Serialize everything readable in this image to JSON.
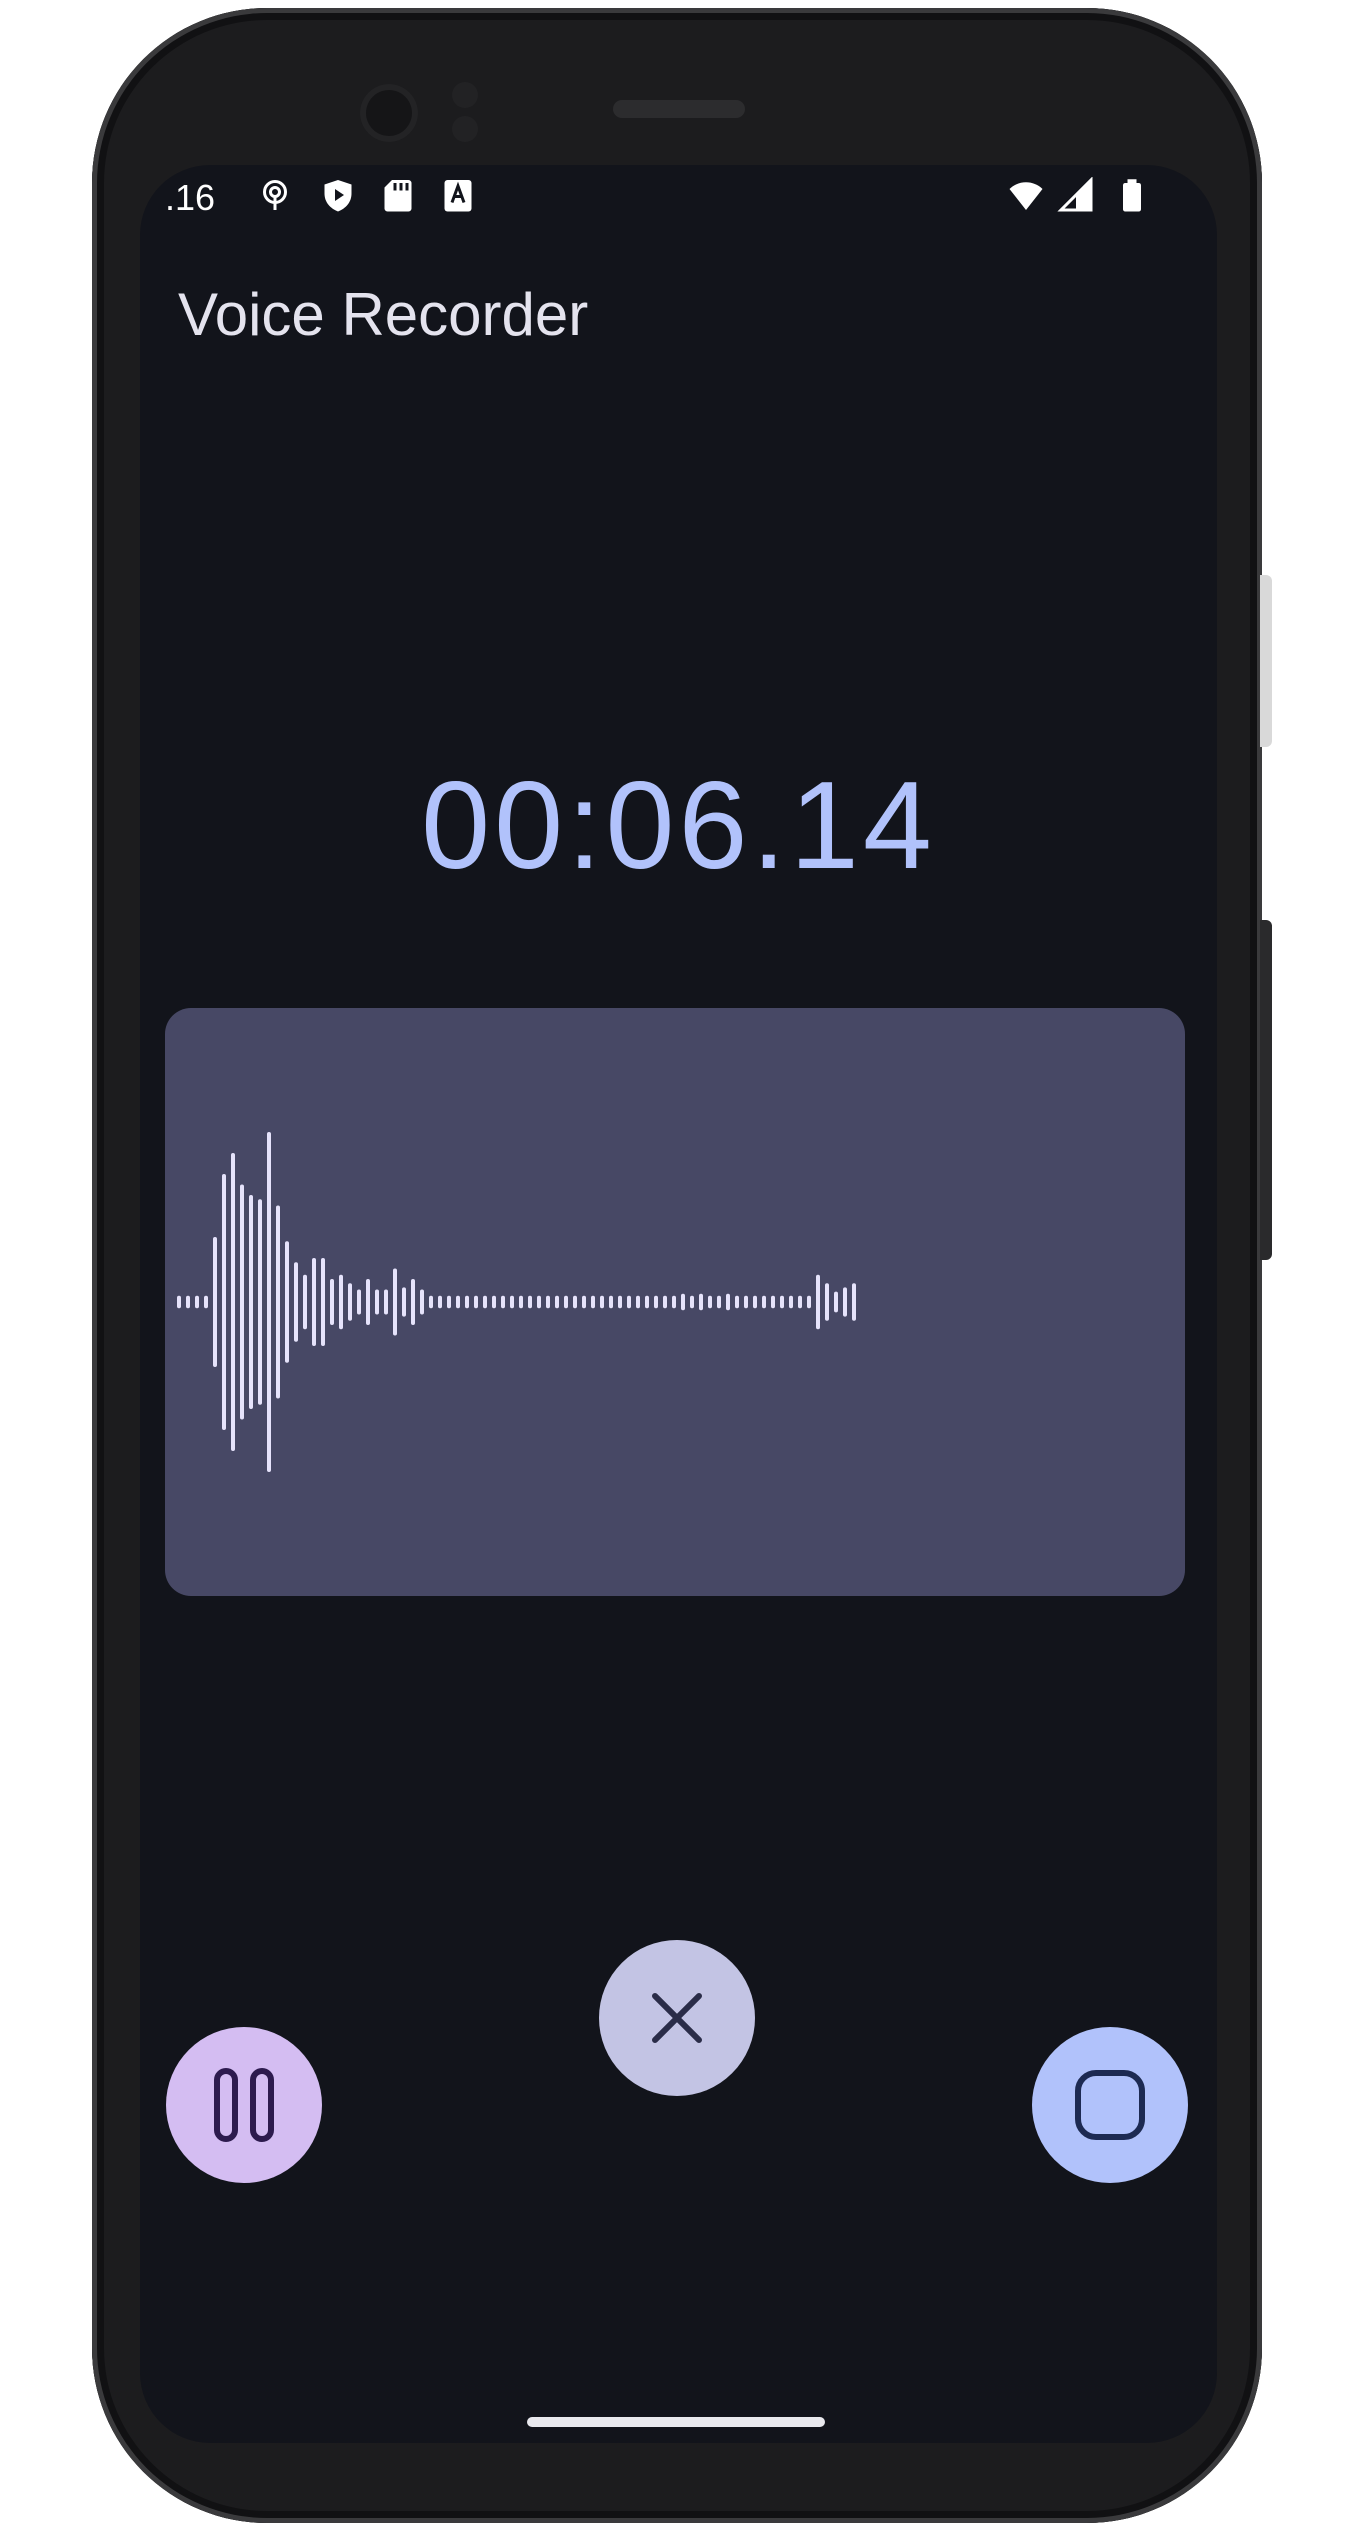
{
  "status_bar": {
    "time": ".16",
    "left_icons": [
      "podcast-icon",
      "shield-play-icon",
      "sd-card-icon",
      "font-a-icon"
    ],
    "right_icons": [
      "wifi-icon",
      "signal-icon",
      "battery-icon"
    ]
  },
  "app": {
    "title": "Voice Recorder"
  },
  "recorder": {
    "elapsed": "00:06.14",
    "waveform_amplitudes": [
      0.02,
      0.02,
      0.02,
      0.02,
      0.3,
      0.6,
      0.7,
      0.55,
      0.5,
      0.48,
      0.8,
      0.45,
      0.28,
      0.18,
      0.12,
      0.2,
      0.2,
      0.1,
      0.12,
      0.08,
      0.05,
      0.1,
      0.05,
      0.05,
      0.15,
      0.06,
      0.1,
      0.05,
      0.02,
      0.02,
      0.02,
      0.02,
      0.02,
      0.02,
      0.02,
      0.02,
      0.02,
      0.02,
      0.02,
      0.02,
      0.02,
      0.02,
      0.02,
      0.02,
      0.02,
      0.02,
      0.02,
      0.02,
      0.02,
      0.02,
      0.02,
      0.02,
      0.02,
      0.02,
      0.02,
      0.02,
      0.03,
      0.02,
      0.03,
      0.02,
      0.02,
      0.03,
      0.02,
      0.02,
      0.02,
      0.02,
      0.02,
      0.02,
      0.02,
      0.02,
      0.02,
      0.12,
      0.08,
      0.04,
      0.06,
      0.08
    ]
  },
  "controls": {
    "pause_icon": "pause-icon",
    "cancel_icon": "close-icon",
    "stop_icon": "stop-icon"
  },
  "colors": {
    "background": "#12141b",
    "accent": "#b1c2fb",
    "waveform_card": "#474865",
    "waveform_bars": "#e6e3fb",
    "pause_button": "#d4bdf2",
    "cancel_button": "#c3c4e4",
    "stop_button": "#b1c2fb",
    "icon_dark": "#1d2a52"
  }
}
